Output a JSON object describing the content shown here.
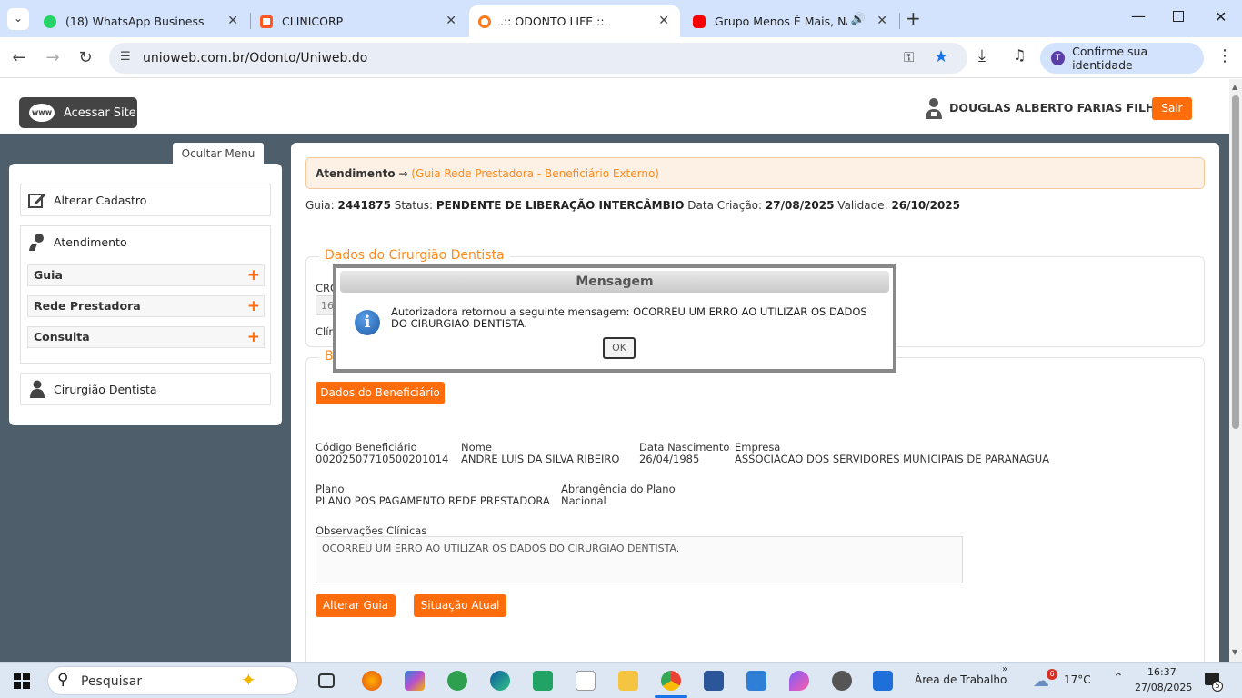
{
  "browser": {
    "tabs": [
      {
        "title": "(18) WhatsApp Business",
        "color": "#25d366"
      },
      {
        "title": "CLINICORP",
        "color": "#ff5722"
      },
      {
        "title": ".:: ODONTO LIFE ::.",
        "color": "#ff7a1c"
      },
      {
        "title": "Grupo Menos É Mais, NATTAN",
        "color": "#ff0000"
      }
    ],
    "url": "unioweb.com.br/Odonto/Uniweb.do",
    "identity_label": "Confirme sua identidade",
    "identity_initial": "T"
  },
  "header": {
    "site_button": "Acessar Site",
    "site_icon_text": "www",
    "user_name": "DOUGLAS ALBERTO FARIAS FILHO",
    "logout": "Sair"
  },
  "sidebar": {
    "toggle": "Ocultar Menu",
    "items": [
      {
        "label": "Alterar Cadastro"
      },
      {
        "label": "Atendimento",
        "children": [
          {
            "label": "Guia"
          },
          {
            "label": "Rede Prestadora"
          },
          {
            "label": "Consulta"
          }
        ]
      },
      {
        "label": "Cirurgião Dentista"
      }
    ],
    "plus_glyph": "+"
  },
  "breadcrumb": {
    "root": "Atendimento",
    "arrow": "→",
    "current": "(Guia Rede Prestadora - Beneficiário Externo)"
  },
  "guia": {
    "guia_label": "Guia:",
    "guia_value": "2441875",
    "status_label": "Status:",
    "status_value": "PENDENTE DE LIBERAÇÃO INTERCÂMBIO",
    "criacao_label": "Data Criação:",
    "criacao_value": "27/08/2025",
    "validade_label": "Validade:",
    "validade_value": "26/10/2025"
  },
  "dentista_section": {
    "legend": "Dados do Cirurgião Dentista",
    "cro_label": "CRO",
    "cro_value": "16",
    "clinica_label": "Clín"
  },
  "beneficiario_section": {
    "legend": "B",
    "dados_button": "Dados do Beneficiário",
    "codigo_label": "Código Beneficiário",
    "codigo_value": "00202507710500201014",
    "nome_label": "Nome",
    "nome_value": "ANDRE LUIS DA SILVA RIBEIRO",
    "nascimento_label": "Data Nascimento",
    "nascimento_value": "26/04/1985",
    "empresa_label": "Empresa",
    "empresa_value": "ASSOCIACAO DOS SERVIDORES MUNICIPAIS DE PARANAGUA",
    "plano_label": "Plano",
    "plano_value": "PLANO POS PAGAMENTO REDE PRESTADORA",
    "abrangencia_label": "Abrangência do Plano",
    "abrangencia_value": "Nacional",
    "obs_label": "Observações Clínicas",
    "obs_value": "OCORREU UM ERRO AO UTILIZAR OS DADOS DO CIRURGIAO DENTISTA.",
    "alterar_button": "Alterar Guia",
    "situacao_button": "Situação Atual"
  },
  "dialog": {
    "title": "Mensagem",
    "icon_glyph": "i",
    "message": "Autorizadora retornou a seguinte mensagem: OCORREU UM ERRO AO UTILIZAR OS DADOS DO CIRURGIAO DENTISTA.",
    "ok": "OK"
  },
  "taskbar": {
    "search_placeholder": "Pesquisar",
    "desktop_label": "Área de Trabalho",
    "weather_badge": "6",
    "temperature": "17°C",
    "time": "16:37",
    "date": "27/08/2025",
    "notification_count": "5"
  }
}
